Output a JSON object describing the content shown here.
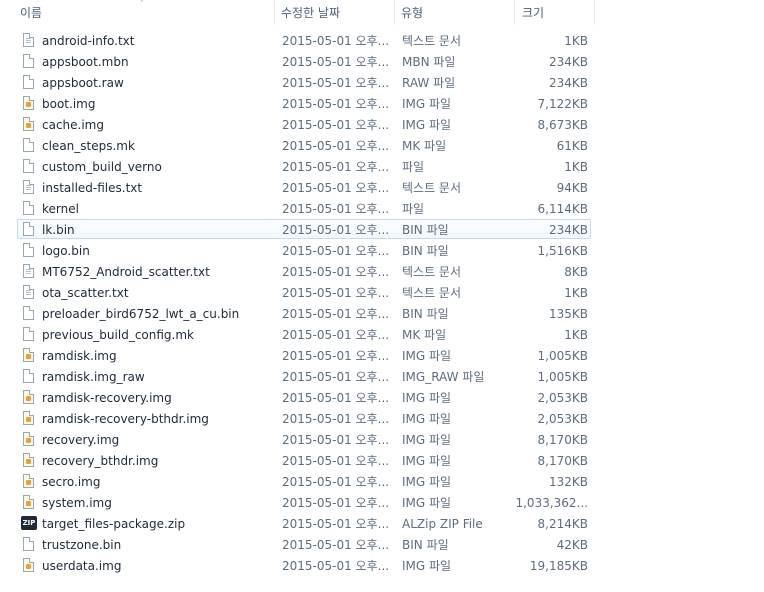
{
  "columns": {
    "name": "이름",
    "date": "수정한 날짜",
    "type": "유형",
    "size": "크기"
  },
  "sort_indicator": "˄",
  "zip_badge": "ZIP",
  "files": [
    {
      "name": "android-info.txt",
      "date": "2015-05-01 오후...",
      "type": "텍스트 문서",
      "size": "1KB",
      "icon": "text-file-icon"
    },
    {
      "name": "appsboot.mbn",
      "date": "2015-05-01 오후...",
      "type": "MBN 파일",
      "size": "234KB",
      "icon": "file-icon"
    },
    {
      "name": "appsboot.raw",
      "date": "2015-05-01 오후...",
      "type": "RAW 파일",
      "size": "234KB",
      "icon": "file-icon"
    },
    {
      "name": "boot.img",
      "date": "2015-05-01 오후...",
      "type": "IMG 파일",
      "size": "7,122KB",
      "icon": "image-file-icon"
    },
    {
      "name": "cache.img",
      "date": "2015-05-01 오후...",
      "type": "IMG 파일",
      "size": "8,673KB",
      "icon": "image-file-icon"
    },
    {
      "name": "clean_steps.mk",
      "date": "2015-05-01 오후...",
      "type": "MK 파일",
      "size": "61KB",
      "icon": "file-icon"
    },
    {
      "name": "custom_build_verno",
      "date": "2015-05-01 오후...",
      "type": "파일",
      "size": "1KB",
      "icon": "file-icon"
    },
    {
      "name": "installed-files.txt",
      "date": "2015-05-01 오후...",
      "type": "텍스트 문서",
      "size": "94KB",
      "icon": "text-file-icon"
    },
    {
      "name": "kernel",
      "date": "2015-05-01 오후...",
      "type": "파일",
      "size": "6,114KB",
      "icon": "file-icon"
    },
    {
      "name": "lk.bin",
      "date": "2015-05-01 오후...",
      "type": "BIN 파일",
      "size": "234KB",
      "icon": "file-icon",
      "selected": true
    },
    {
      "name": "logo.bin",
      "date": "2015-05-01 오후...",
      "type": "BIN 파일",
      "size": "1,516KB",
      "icon": "file-icon"
    },
    {
      "name": "MT6752_Android_scatter.txt",
      "date": "2015-05-01 오후...",
      "type": "텍스트 문서",
      "size": "8KB",
      "icon": "text-file-icon"
    },
    {
      "name": "ota_scatter.txt",
      "date": "2015-05-01 오후...",
      "type": "텍스트 문서",
      "size": "1KB",
      "icon": "text-file-icon"
    },
    {
      "name": "preloader_bird6752_lwt_a_cu.bin",
      "date": "2015-05-01 오후...",
      "type": "BIN 파일",
      "size": "135KB",
      "icon": "file-icon"
    },
    {
      "name": "previous_build_config.mk",
      "date": "2015-05-01 오후...",
      "type": "MK 파일",
      "size": "1KB",
      "icon": "file-icon"
    },
    {
      "name": "ramdisk.img",
      "date": "2015-05-01 오후...",
      "type": "IMG 파일",
      "size": "1,005KB",
      "icon": "image-file-icon"
    },
    {
      "name": "ramdisk.img_raw",
      "date": "2015-05-01 오후...",
      "type": "IMG_RAW 파일",
      "size": "1,005KB",
      "icon": "file-icon"
    },
    {
      "name": "ramdisk-recovery.img",
      "date": "2015-05-01 오후...",
      "type": "IMG 파일",
      "size": "2,053KB",
      "icon": "image-file-icon"
    },
    {
      "name": "ramdisk-recovery-bthdr.img",
      "date": "2015-05-01 오후...",
      "type": "IMG 파일",
      "size": "2,053KB",
      "icon": "image-file-icon"
    },
    {
      "name": "recovery.img",
      "date": "2015-05-01 오후...",
      "type": "IMG 파일",
      "size": "8,170KB",
      "icon": "image-file-icon"
    },
    {
      "name": "recovery_bthdr.img",
      "date": "2015-05-01 오후...",
      "type": "IMG 파일",
      "size": "8,170KB",
      "icon": "image-file-icon"
    },
    {
      "name": "secro.img",
      "date": "2015-05-01 오후...",
      "type": "IMG 파일",
      "size": "132KB",
      "icon": "image-file-icon"
    },
    {
      "name": "system.img",
      "date": "2015-05-01 오후...",
      "type": "IMG 파일",
      "size": "1,033,362...",
      "icon": "image-file-icon"
    },
    {
      "name": "target_files-package.zip",
      "date": "2015-05-01 오후...",
      "type": "ALZip ZIP File",
      "size": "8,214KB",
      "icon": "zip-file-icon"
    },
    {
      "name": "trustzone.bin",
      "date": "2015-05-01 오후...",
      "type": "BIN 파일",
      "size": "42KB",
      "icon": "file-icon"
    },
    {
      "name": "userdata.img",
      "date": "2015-05-01 오후...",
      "type": "IMG 파일",
      "size": "19,185KB",
      "icon": "image-file-icon"
    }
  ]
}
